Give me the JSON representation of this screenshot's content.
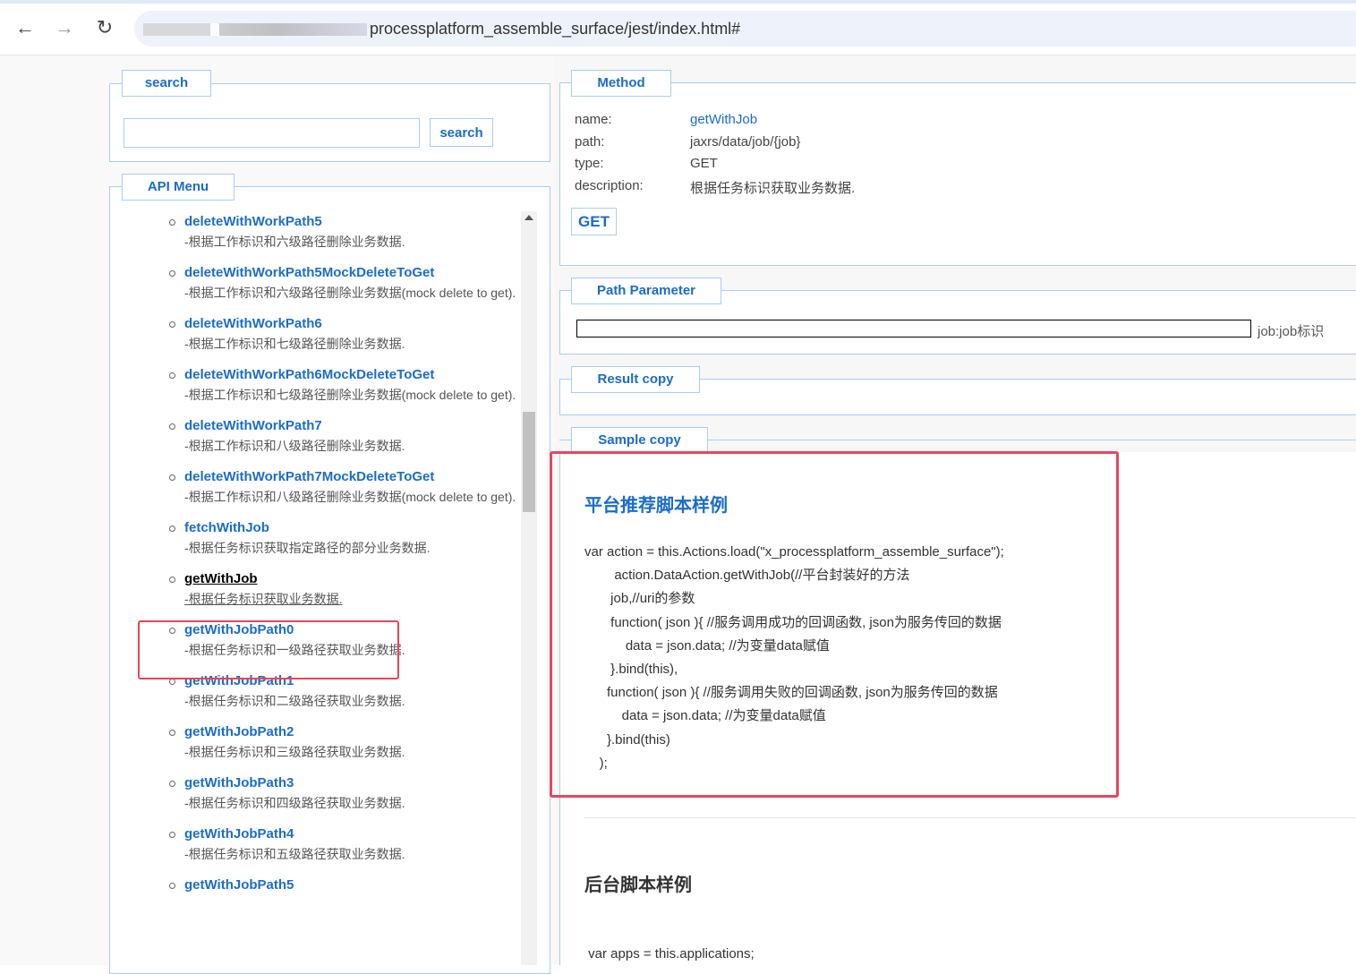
{
  "browser": {
    "url": "processplatform_assemble_surface/jest/index.html#",
    "back": "←",
    "forward": "→",
    "reload": "↻"
  },
  "search": {
    "legend": "search",
    "button": "search",
    "value": ""
  },
  "menu": {
    "legend": "API Menu",
    "items": [
      {
        "title": "deleteWithWorkPath5",
        "desc": "-根据工作标识和六级路径删除业务数据."
      },
      {
        "title": "deleteWithWorkPath5MockDeleteToGet",
        "desc": "-根据工作标识和六级路径删除业务数据(mock delete to get)."
      },
      {
        "title": "deleteWithWorkPath6",
        "desc": "-根据工作标识和七级路径删除业务数据."
      },
      {
        "title": "deleteWithWorkPath6MockDeleteToGet",
        "desc": "-根据工作标识和七级路径删除业务数据(mock delete to get)."
      },
      {
        "title": "deleteWithWorkPath7",
        "desc": "-根据工作标识和八级路径删除业务数据."
      },
      {
        "title": "deleteWithWorkPath7MockDeleteToGet",
        "desc": "-根据工作标识和八级路径删除业务数据(mock delete to get)."
      },
      {
        "title": "fetchWithJob",
        "desc": "-根据任务标识获取指定路径的部分业务数据."
      },
      {
        "title": "getWithJob",
        "desc": "-根据任务标识获取业务数据."
      },
      {
        "title": "getWithJobPath0",
        "desc": "-根据任务标识和一级路径获取业务数据."
      },
      {
        "title": "getWithJobPath1",
        "desc": "-根据任务标识和二级路径获取业务数据."
      },
      {
        "title": "getWithJobPath2",
        "desc": "-根据任务标识和三级路径获取业务数据."
      },
      {
        "title": "getWithJobPath3",
        "desc": "-根据任务标识和四级路径获取业务数据."
      },
      {
        "title": "getWithJobPath4",
        "desc": "-根据任务标识和五级路径获取业务数据."
      },
      {
        "title": "getWithJobPath5",
        "desc": ""
      }
    ]
  },
  "method": {
    "legend": "Method",
    "name_label": "name:",
    "name": "getWithJob",
    "path_label": "path:",
    "path": "jaxrs/data/job/{job}",
    "type_label": "type:",
    "type": "GET",
    "desc_label": "description:",
    "desc": "根据任务标识获取业务数据.",
    "button": "GET"
  },
  "path_param": {
    "legend": "Path Parameter",
    "value": "",
    "label": "job:job标识"
  },
  "result": {
    "legend": "Result copy"
  },
  "sample": {
    "legend": "Sample copy",
    "heading1": "平台推荐脚本样例",
    "code": [
      "var action = this.Actions.load(\"x_processplatform_assemble_surface\");",
      "        action.DataAction.getWithJob(//平台封装好的方法",
      "       job,//uri的参数",
      "       function( json ){ //服务调用成功的回调函数, json为服务传回的数据",
      "           data = json.data; //为变量data赋值",
      "       }.bind(this),",
      "      function( json ){ //服务调用失败的回调函数, json为服务传回的数据",
      "          data = json.data; //为变量data赋值",
      "      }.bind(this)",
      "    );"
    ],
    "heading2": "后台脚本样例",
    "code2": " var apps = this.applications;"
  }
}
